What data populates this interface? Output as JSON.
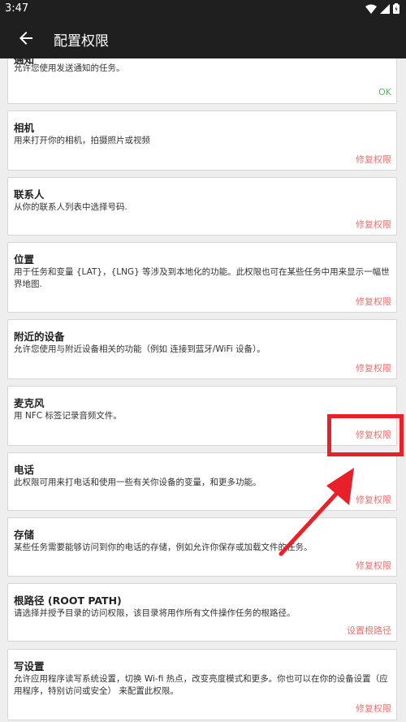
{
  "status": {
    "time": "3:47"
  },
  "appbar": {
    "title": "配置权限"
  },
  "cards": [
    {
      "title": "通知",
      "desc": "允许您使用发送通知的任务。",
      "action": "OK"
    },
    {
      "title": "相机",
      "desc": "用来打开你的相机，拍摄照片或视频",
      "action": "修复权限"
    },
    {
      "title": "联系人",
      "desc": "从你的联系人列表中选择号码.",
      "action": "修复权限"
    },
    {
      "title": "位置",
      "desc": "用于任务和变量 {LAT}，{LNG} 等涉及到本地化的功能。此权限也可在某些任务中用来显示一幅世界地图.",
      "action": "修复权限"
    },
    {
      "title": "附近的设备",
      "desc": "允许您使用与附近设备相关的功能（例如 连接到蓝牙/WiFi 设备）。",
      "action": "修复权限"
    },
    {
      "title": "麦克风",
      "desc": "用 NFC 标签记录音频文件。",
      "action": "修复权限"
    },
    {
      "title": "电话",
      "desc": "此权限可用来打电话和使用一些有关你设备的变量，和更多功能。",
      "action": "修复权限"
    },
    {
      "title": "存储",
      "desc": "某些任务需要能够访问到你的电话的存储，例如允许你保存或加载文件的任务。",
      "action": "修复权限"
    },
    {
      "title": "根路径 (ROOT PATH)",
      "desc": "请选择并授予目录的访问权限，该目录将用作所有文件操作任务的根路径。",
      "action": "设置根路径"
    },
    {
      "title": "写设置",
      "desc": "允许应用程序读写系统设置，切换 Wi-fi 热点，改变亮度模式和更多。你也可以在你的设备设置（应用程序，特别访问或安全） 来配置此权限。",
      "action": "修复权限"
    }
  ],
  "colors": {
    "appbar": "#1f1f1f",
    "action": "#e57373",
    "ok": "#5cb85c",
    "annotation": "#e8202a"
  }
}
